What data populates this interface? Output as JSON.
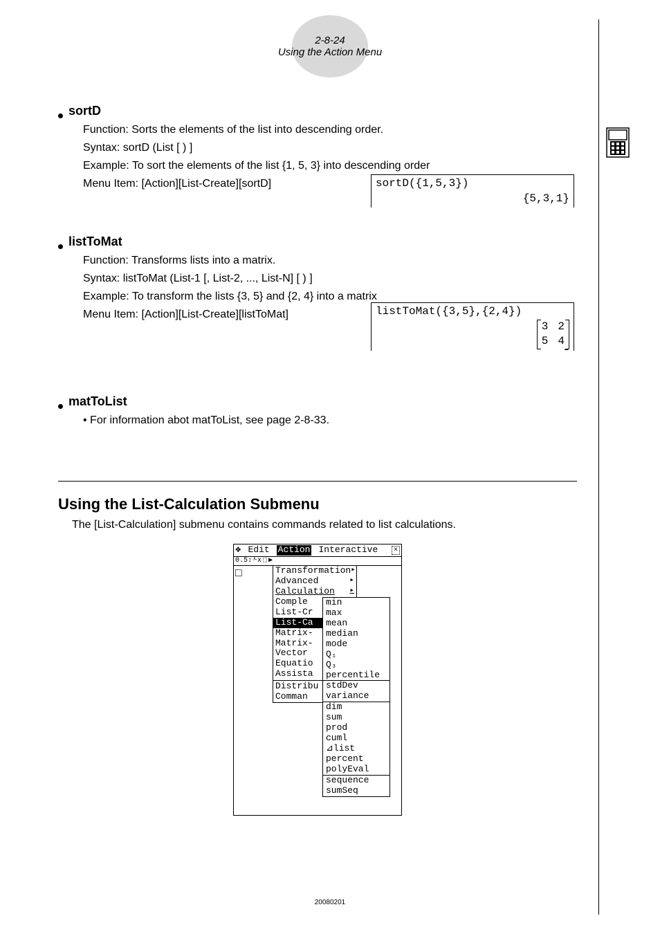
{
  "header": {
    "page_no": "2-8-24",
    "title": "Using the Action Menu"
  },
  "sortD": {
    "title": "sortD",
    "function": "Function: Sorts the elements of the list into descending order.",
    "syntax": "Syntax: sortD (List [ ) ]",
    "example": "Example: To sort the elements of the list {1, 5, 3} into descending order",
    "menu": "Menu Item: [Action][List-Create][sortD]",
    "calc_input": "sortD({1,5,3})",
    "calc_output": "{5,3,1}"
  },
  "listToMat": {
    "title": "listToMat",
    "function": "Function: Transforms lists into a matrix.",
    "syntax": "Syntax: listToMat (List-1 [, List-2, ..., List-N] [ ) ]",
    "example": "Example: To transform the lists {3, 5} and {2, 4} into a matrix",
    "menu": "Menu Item: [Action][List-Create][listToMat]",
    "calc_input": "listToMat({3,5},{2,4})",
    "mat_r1c1": "3",
    "mat_r1c2": "2",
    "mat_r2c1": "5",
    "mat_r2c2": "4"
  },
  "matToList": {
    "title": "matToList",
    "note": "• For information abot matToList, see page 2-8-33."
  },
  "listCalc": {
    "heading": "Using the List-Calculation Submenu",
    "desc": "The [List-Calculation] submenu contains commands related to list calculations."
  },
  "calc": {
    "menubar": {
      "edit": "Edit",
      "action": "Action",
      "interactive": "Interactive",
      "close": "×"
    },
    "toolbar": [
      "0.5↕",
      "⅟x",
      "⬚",
      "▶"
    ],
    "work_cursor": "□",
    "menu_main": [
      {
        "label": "Transformation",
        "arrow": true
      },
      {
        "label": "Advanced",
        "arrow": true
      },
      {
        "label": "Calculation",
        "arrow": true,
        "underline": true
      },
      {
        "label": "Comple"
      },
      {
        "label": "List-Cr"
      },
      {
        "label": "List-Ca",
        "selected": true
      },
      {
        "label": "Matrix-"
      },
      {
        "label": "Matrix-"
      },
      {
        "label": "Vector"
      },
      {
        "label": "Equatio"
      },
      {
        "label": "Assista"
      },
      {
        "label": "Distribu",
        "sepBefore": true
      },
      {
        "label": "Comman"
      }
    ],
    "submenu": [
      [
        "min",
        "max",
        "mean",
        "median",
        "mode",
        "Q₁",
        "Q₃",
        "percentile"
      ],
      [
        "stdDev",
        "variance"
      ],
      [
        "dim",
        "sum",
        "prod",
        "cuml",
        "⊿list",
        "percent",
        "polyEval"
      ],
      [
        "sequence",
        "sumSeq"
      ]
    ]
  },
  "footer_code": "20080201"
}
